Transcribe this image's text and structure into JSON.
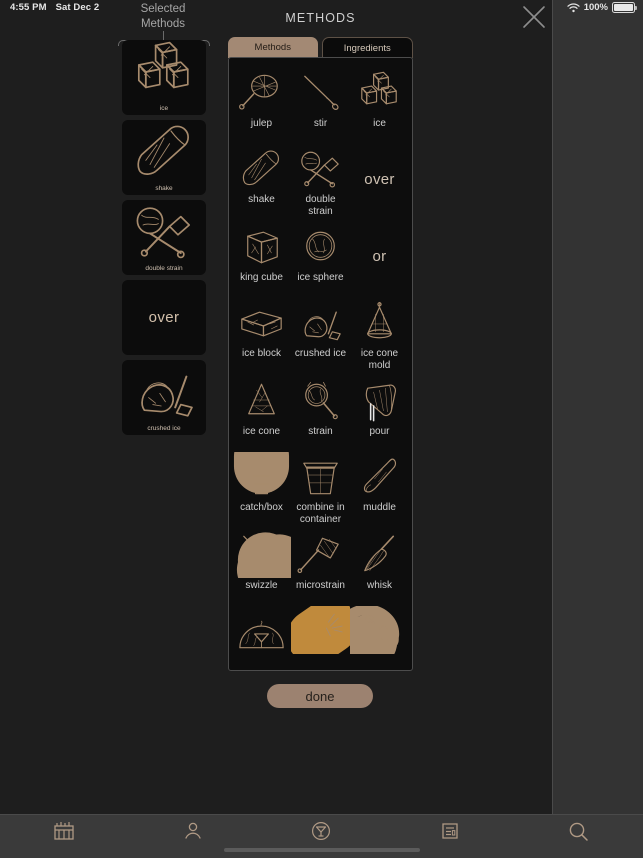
{
  "statusbar": {
    "time": "4:55 PM",
    "date": "Sat Dec 2",
    "wifi_icon": "wifi-icon",
    "battery_percent": "100%",
    "battery_icon": "battery-full-icon"
  },
  "selected_panel": {
    "title": "Selected\nMethods",
    "title_line1": "Selected",
    "title_line2": "Methods",
    "items": [
      {
        "label": "ice",
        "type": "icon",
        "icon": "ice-cubes-icon"
      },
      {
        "label": "shake",
        "type": "icon",
        "icon": "shaker-icon"
      },
      {
        "label": "double strain",
        "type": "icon",
        "icon": "double-strain-icon"
      },
      {
        "label": "over",
        "type": "text",
        "icon": ""
      },
      {
        "label": "crushed ice",
        "type": "icon",
        "icon": "crushed-ice-icon"
      }
    ]
  },
  "modal": {
    "title": "METHODS",
    "close_icon": "close-icon",
    "tabs": [
      {
        "label": "Methods",
        "active": true
      },
      {
        "label": "Ingredients",
        "active": false
      }
    ],
    "done_label": "done",
    "grid": [
      {
        "label": "julep",
        "type": "icon",
        "icon": "julep-strainer-icon"
      },
      {
        "label": "stir",
        "type": "icon",
        "icon": "bar-spoon-icon"
      },
      {
        "label": "ice",
        "type": "icon",
        "icon": "ice-cubes-icon"
      },
      {
        "label": "shake",
        "type": "icon",
        "icon": "shaker-icon"
      },
      {
        "label": "double strain",
        "type": "icon",
        "icon": "double-strain-icon"
      },
      {
        "label": "over",
        "type": "text",
        "icon": ""
      },
      {
        "label": "king cube",
        "type": "icon",
        "icon": "king-cube-icon"
      },
      {
        "label": "ice sphere",
        "type": "icon",
        "icon": "ice-sphere-icon"
      },
      {
        "label": "or",
        "type": "text",
        "icon": ""
      },
      {
        "label": "ice block",
        "type": "icon",
        "icon": "ice-block-icon"
      },
      {
        "label": "crushed ice",
        "type": "icon",
        "icon": "crushed-ice-icon"
      },
      {
        "label": "ice cone mold",
        "type": "icon",
        "icon": "ice-cone-mold-icon"
      },
      {
        "label": "ice cone",
        "type": "icon",
        "icon": "ice-cone-icon"
      },
      {
        "label": "strain",
        "type": "icon",
        "icon": "hawthorne-strainer-icon"
      },
      {
        "label": "pour",
        "type": "icon",
        "icon": "pour-icon"
      },
      {
        "label": "catch/box",
        "type": "icon",
        "icon": "catch-box-icon"
      },
      {
        "label": "combine in container",
        "type": "icon",
        "icon": "container-icon"
      },
      {
        "label": "muddle",
        "type": "icon",
        "icon": "muddler-icon"
      },
      {
        "label": "swizzle",
        "type": "icon",
        "icon": "swizzle-stick-icon"
      },
      {
        "label": "microstrain",
        "type": "icon",
        "icon": "microstrain-icon"
      },
      {
        "label": "whisk",
        "type": "icon",
        "icon": "whisk-icon"
      },
      {
        "label": "",
        "type": "icon",
        "icon": "dome-glass-icon"
      },
      {
        "label": "",
        "type": "icon",
        "icon": "torch-icon"
      },
      {
        "label": "",
        "type": "icon",
        "icon": "teapot-icon"
      }
    ]
  },
  "tabbar": {
    "items": [
      {
        "name": "bar-icon",
        "label": ""
      },
      {
        "name": "person-icon",
        "label": ""
      },
      {
        "name": "cocktail-icon",
        "label": ""
      },
      {
        "name": "recipe-list-icon",
        "label": ""
      },
      {
        "name": "search-icon",
        "label": ""
      }
    ]
  },
  "colors": {
    "accent": "#a38974",
    "background": "#1e1e1e",
    "panel": "#0d0d0d",
    "text": "#cfcfcf"
  }
}
